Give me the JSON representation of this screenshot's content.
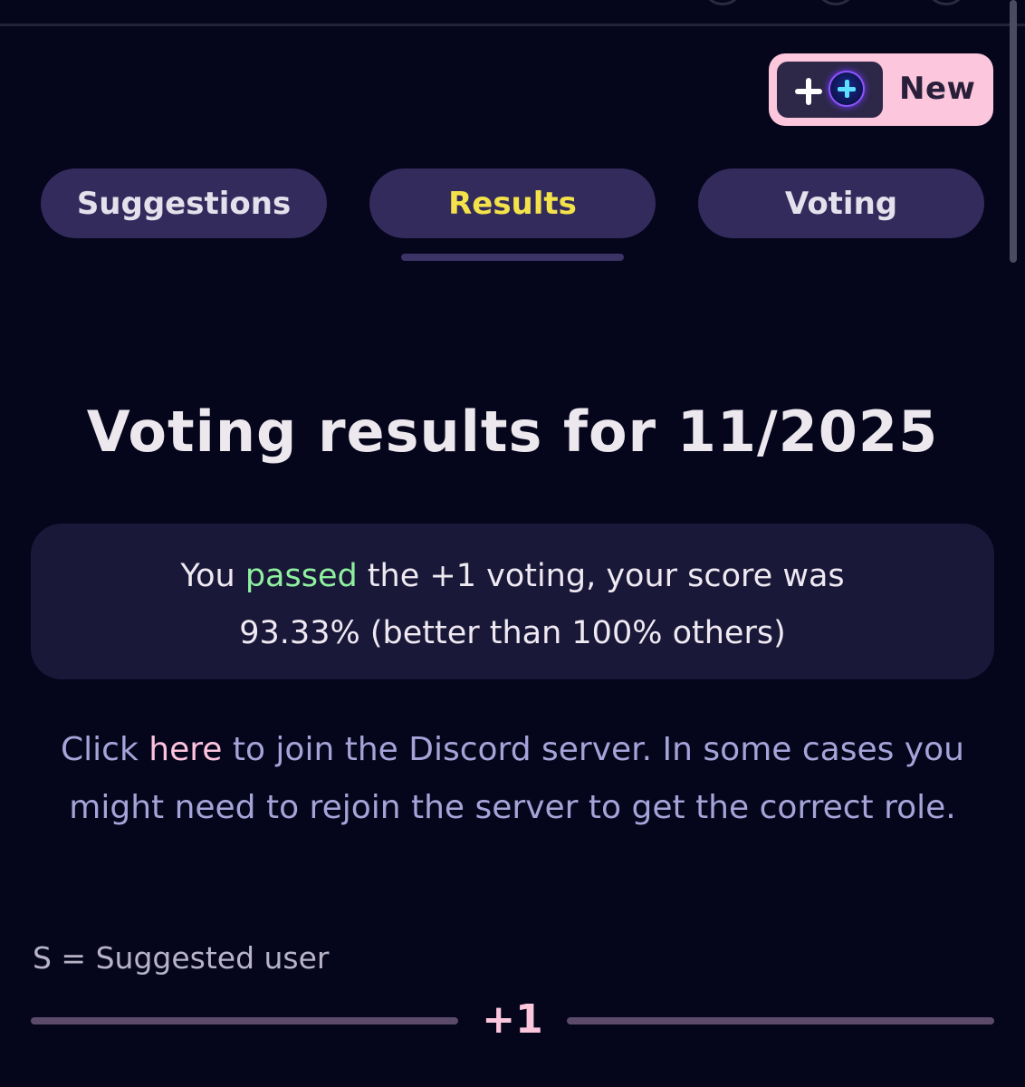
{
  "new_button": {
    "label": "New",
    "icons": [
      "plus-icon",
      "plus-circle-icon"
    ]
  },
  "tabs": [
    {
      "label": "Suggestions",
      "active": false
    },
    {
      "label": "Results",
      "active": true
    },
    {
      "label": "Voting",
      "active": false
    }
  ],
  "results": {
    "title": "Voting results for 11/2025",
    "summary": {
      "prefix": "You ",
      "status": "passed",
      "middle": " the +1 voting, your score was",
      "line2": "93.33% (better than 100% others)"
    },
    "score_percent": 93.33,
    "better_than_percent": 100
  },
  "discord": {
    "prefix": "Click ",
    "link": "here",
    "suffix": " to join the Discord server. In some cases you might need to rejoin the server to get the correct role."
  },
  "legend": {
    "text": "S = Suggested user"
  },
  "section": {
    "label": "+1"
  },
  "colors": {
    "background": "#05051c",
    "tab_background": "#332b5c",
    "active_tab_text": "#f3e24a",
    "passed_text": "#8ff0a0",
    "link_text": "#fdc3de",
    "new_button_background": "#fcc6dc"
  }
}
